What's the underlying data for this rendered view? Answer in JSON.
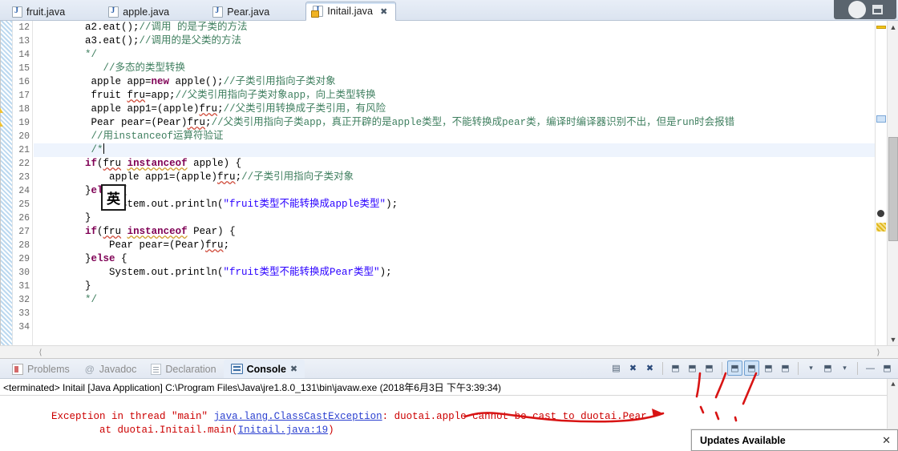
{
  "window": {
    "minimize_label": "",
    "restore_label": ""
  },
  "editor_tabs": [
    {
      "label": "fruit.java",
      "icon": "java-file-icon",
      "active": false,
      "close": ""
    },
    {
      "label": "apple.java",
      "icon": "java-file-icon",
      "active": false,
      "close": ""
    },
    {
      "label": "Pear.java",
      "icon": "java-file-icon",
      "active": false,
      "close": ""
    },
    {
      "label": "Initail.java",
      "icon": "java-file-locked-icon",
      "active": true,
      "close": "✖"
    }
  ],
  "editor": {
    "first_line": 12,
    "current_line": 21,
    "warning_lines": [
      18,
      19
    ],
    "ime_indicator": "英",
    "lines": [
      {
        "no": 12,
        "text": "        a2.eat();//调用 的是子类的方法"
      },
      {
        "no": 13,
        "text": "        a3.eat();//调用的是父类的方法"
      },
      {
        "no": 14,
        "text": "        */"
      },
      {
        "no": 15,
        "text": "           //多态的类型转换"
      },
      {
        "no": 16,
        "text": "         apple app=new apple();//子类引用指向子类对象"
      },
      {
        "no": 17,
        "text": "         fruit fru=app;//父类引用指向子类对象app，向上类型转换"
      },
      {
        "no": 18,
        "text": "         apple app1=(apple)fru;//父类引用转换成子类引用，有风险"
      },
      {
        "no": 19,
        "text": "         Pear pear=(Pear)fru;//父类引用指向子类app，真正开辟的是apple类型，不能转换成pear类，编译时编译器识别不出，但是run时会报错"
      },
      {
        "no": 20,
        "text": "         //用instanceof运算符验证"
      },
      {
        "no": 21,
        "text": "         /*"
      },
      {
        "no": 22,
        "text": "        if(fru instanceof apple) {"
      },
      {
        "no": 23,
        "text": "            apple app1=(apple)fru;//子类引用指向子类对象"
      },
      {
        "no": 24,
        "text": "        }else {"
      },
      {
        "no": 25,
        "text": "            System.out.println(\"fruit类型不能转换成apple类型\");"
      },
      {
        "no": 26,
        "text": "        }"
      },
      {
        "no": 27,
        "text": "        if(fru instanceof Pear) {"
      },
      {
        "no": 28,
        "text": "            Pear pear=(Pear)fru;"
      },
      {
        "no": 29,
        "text": "        }else {"
      },
      {
        "no": 30,
        "text": "            System.out.println(\"fruit类型不能转换成Pear类型\");"
      },
      {
        "no": 31,
        "text": "        }"
      },
      {
        "no": 32,
        "text": "        */"
      },
      {
        "no": 33,
        "text": ""
      },
      {
        "no": 34,
        "text": ""
      }
    ]
  },
  "bottom_view": {
    "tabs": [
      {
        "label": "Problems",
        "icon": "problems-icon",
        "active": false
      },
      {
        "label": "Javadoc",
        "icon": "javadoc-icon",
        "active": false
      },
      {
        "label": "Declaration",
        "icon": "declaration-icon",
        "active": false
      },
      {
        "label": "Console",
        "icon": "console-icon",
        "active": true,
        "close": "✖"
      }
    ],
    "toolbar": [
      {
        "name": "terminate-all-icon",
        "glyph": "▤",
        "selected": false
      },
      {
        "name": "remove-launch-icon",
        "glyph": "✖",
        "selected": false
      },
      {
        "name": "remove-all-terminated-icon",
        "glyph": "✖",
        "selected": false
      },
      {
        "name": "clear-console-icon",
        "glyph": "⬒",
        "selected": false
      },
      {
        "name": "scroll-lock-icon",
        "glyph": "⬒",
        "selected": false
      },
      {
        "name": "word-wrap-icon",
        "glyph": "⬒",
        "selected": false
      },
      {
        "name": "show-console-on-output-icon",
        "glyph": "⬒",
        "selected": true
      },
      {
        "name": "show-console-on-error-icon",
        "glyph": "⬒",
        "selected": true
      },
      {
        "name": "pin-console-icon",
        "glyph": "⬒",
        "selected": false
      },
      {
        "name": "display-selected-console-icon",
        "glyph": "⬒",
        "selected": false
      },
      {
        "name": "display-selected-console-dropdown-icon",
        "glyph": "▾",
        "selected": false
      },
      {
        "name": "open-console-icon",
        "glyph": "⬒",
        "selected": false
      },
      {
        "name": "open-console-dropdown-icon",
        "glyph": "▾",
        "selected": false
      },
      {
        "name": "minimize-view-icon",
        "glyph": "—",
        "selected": false
      },
      {
        "name": "maximize-view-icon",
        "glyph": "⬒",
        "selected": false
      }
    ],
    "console": {
      "header": "<terminated> Initail [Java Application] C:\\Program Files\\Java\\jre1.8.0_131\\bin\\javaw.exe (2018年6月3日 下午3:39:34)",
      "error_line_1_prefix": "Exception in thread \"main\" ",
      "error_line_1_link": "java.lang.ClassCastException",
      "error_line_1_suffix": ": duotai.apple cannot be cast to duotai.Pear",
      "error_line_2_prefix": "        at duotai.Initail.main(",
      "error_line_2_link": "Initail.java:19",
      "error_line_2_suffix": ")"
    }
  },
  "popup": {
    "title": "Updates Available",
    "close": "✕"
  },
  "colors": {
    "keyword": "#7f0055",
    "comment": "#3f7f5f",
    "string": "#2a00ff",
    "error": "#cc0000",
    "link": "#2a3fd0",
    "annotation": "#d81414",
    "selection": "#cfe3f7"
  }
}
